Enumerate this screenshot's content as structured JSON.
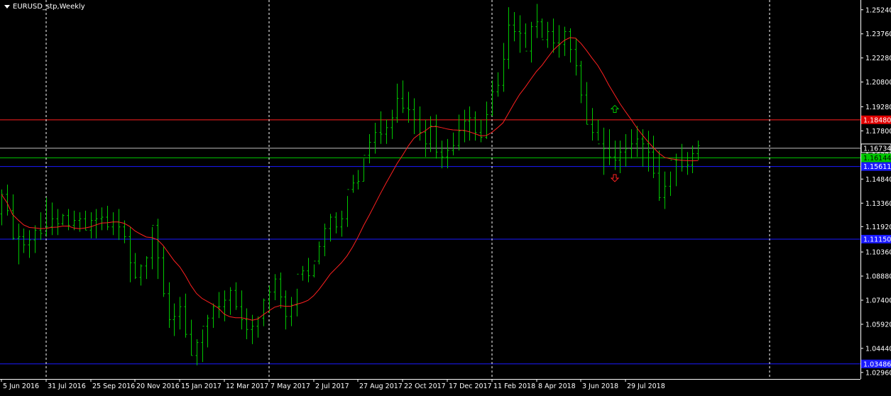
{
  "window": {
    "symbol_title": "EURUSD_stp,Weekly"
  },
  "colors": {
    "background": "#000000",
    "bars": "#00c800",
    "moving_average": "#ff2020",
    "axis_text": "#ffffff",
    "red_level": "#ff2020",
    "blue_level": "#1a1aff",
    "green_level": "#00c800",
    "gray_level": "#c0c0c0",
    "arrow_up": "#00c800",
    "arrow_down": "#ff2020"
  },
  "chart_data": {
    "type": "ohlc",
    "ylim": [
      1.0256,
      1.2584
    ],
    "y_ticks": [
      "1.25240",
      "1.23760",
      "1.22280",
      "1.20800",
      "1.19280",
      "1.17800",
      "1.16320",
      "1.14840",
      "1.13360",
      "1.11920",
      "1.10360",
      "1.08880",
      "1.07400",
      "1.05920",
      "1.04440",
      "1.02960"
    ],
    "x_ticks": [
      "5 Jun 2016",
      "31 Jul 2016",
      "25 Sep 2016",
      "20 Nov 2016",
      "15 Jan 2017",
      "12 Mar 2017",
      "7 May 2017",
      "2 Jul 2017",
      "27 Aug 2017",
      "22 Oct 2017",
      "17 Dec 2017",
      "11 Feb 2018",
      "8 Apr 2018",
      "3 Jun 2018",
      "29 Jul 2018"
    ],
    "levels": [
      {
        "name": "red-resistance",
        "value": 1.1848,
        "label": "1.18480",
        "color": "#ff2020",
        "label_bg": "#e00000"
      },
      {
        "name": "gray-level",
        "value": 1.16734,
        "label": "1.16734",
        "color": "#c0c0c0",
        "label_bg": "#000000"
      },
      {
        "name": "green-current",
        "value": 1.16144,
        "label": "1.16144",
        "color": "#00c800",
        "label_bg": "#00c800"
      },
      {
        "name": "blue-support-1",
        "value": 1.15611,
        "label": "1.15611",
        "color": "#1a1aff",
        "label_bg": "#1a1aff"
      },
      {
        "name": "blue-support-2",
        "value": 1.1115,
        "label": "1.11150",
        "color": "#1a1aff",
        "label_bg": "#1a1aff"
      },
      {
        "name": "blue-support-3",
        "value": 1.03486,
        "label": "1.03486",
        "color": "#1a1aff",
        "label_bg": "#1a1aff"
      }
    ],
    "dashed_separators": [
      1,
      6,
      11
    ],
    "arrows": [
      {
        "name": "buy-arrow",
        "direction": "up",
        "x_index": 14.6,
        "y": 1.1915
      },
      {
        "name": "sell-arrow",
        "direction": "down",
        "x_index": 14.6,
        "y": 1.149
      }
    ],
    "x_start_weeks_before_first_tick": 0,
    "series": [
      {
        "name": "OHLC",
        "open": [
          1.127,
          1.139,
          1.129,
          1.112,
          1.113,
          1.108,
          1.111,
          1.117,
          1.115,
          1.119,
          1.124,
          1.121,
          1.126,
          1.12,
          1.123,
          1.124,
          1.117,
          1.123,
          1.124,
          1.125,
          1.119,
          1.122,
          1.119,
          1.113,
          1.097,
          1.088,
          1.095,
          1.1,
          1.12,
          1.1,
          1.078,
          1.062,
          1.064,
          1.07,
          1.053,
          1.04,
          1.048,
          1.058,
          1.063,
          1.07,
          1.07,
          1.074,
          1.08,
          1.07,
          1.062,
          1.056,
          1.058,
          1.063,
          1.074,
          1.079,
          1.087,
          1.076,
          1.064,
          1.071,
          1.09,
          1.092,
          1.089,
          1.098,
          1.107,
          1.118,
          1.125,
          1.119,
          1.124,
          1.142,
          1.146,
          1.147,
          1.163,
          1.171,
          1.177,
          1.176,
          1.18,
          1.186,
          1.198,
          1.192,
          1.191,
          1.185,
          1.177,
          1.17,
          1.181,
          1.165,
          1.162,
          1.166,
          1.169,
          1.178,
          1.184,
          1.186,
          1.177,
          1.174,
          1.188,
          1.202,
          1.206,
          1.222,
          1.243,
          1.239,
          1.238,
          1.227,
          1.242,
          1.245,
          1.234,
          1.239,
          1.232,
          1.231,
          1.239,
          1.228,
          1.218,
          1.2,
          1.182,
          1.177,
          1.17,
          1.167,
          1.162,
          1.16,
          1.165,
          1.167,
          1.17,
          1.173,
          1.17,
          1.165,
          1.152,
          1.137,
          1.144,
          1.16,
          1.16,
          1.156,
          1.157,
          1.164
        ],
        "high": [
          1.142,
          1.145,
          1.139,
          1.121,
          1.118,
          1.117,
          1.12,
          1.128,
          1.137,
          1.134,
          1.13,
          1.127,
          1.13,
          1.129,
          1.128,
          1.129,
          1.128,
          1.13,
          1.131,
          1.132,
          1.128,
          1.13,
          1.123,
          1.119,
          1.103,
          1.096,
          1.101,
          1.119,
          1.124,
          1.107,
          1.085,
          1.072,
          1.076,
          1.078,
          1.062,
          1.05,
          1.056,
          1.065,
          1.072,
          1.079,
          1.08,
          1.082,
          1.085,
          1.08,
          1.069,
          1.065,
          1.064,
          1.075,
          1.083,
          1.09,
          1.091,
          1.08,
          1.076,
          1.081,
          1.095,
          1.1,
          1.096,
          1.11,
          1.121,
          1.127,
          1.128,
          1.129,
          1.138,
          1.151,
          1.154,
          1.161,
          1.176,
          1.183,
          1.19,
          1.185,
          1.191,
          1.207,
          1.209,
          1.202,
          1.198,
          1.193,
          1.185,
          1.187,
          1.188,
          1.172,
          1.173,
          1.177,
          1.188,
          1.191,
          1.193,
          1.19,
          1.185,
          1.196,
          1.209,
          1.214,
          1.232,
          1.254,
          1.251,
          1.249,
          1.244,
          1.245,
          1.256,
          1.247,
          1.245,
          1.247,
          1.243,
          1.242,
          1.241,
          1.235,
          1.221,
          1.208,
          1.192,
          1.185,
          1.18,
          1.179,
          1.172,
          1.172,
          1.176,
          1.179,
          1.181,
          1.179,
          1.178,
          1.175,
          1.166,
          1.153,
          1.153,
          1.164,
          1.17,
          1.165,
          1.169,
          1.172
        ],
        "low": [
          1.12,
          1.126,
          1.111,
          1.096,
          1.103,
          1.1,
          1.103,
          1.111,
          1.113,
          1.114,
          1.114,
          1.12,
          1.117,
          1.117,
          1.116,
          1.117,
          1.112,
          1.112,
          1.117,
          1.117,
          1.114,
          1.111,
          1.109,
          1.085,
          1.087,
          1.083,
          1.087,
          1.093,
          1.087,
          1.076,
          1.057,
          1.052,
          1.056,
          1.051,
          1.04,
          1.034,
          1.036,
          1.045,
          1.057,
          1.063,
          1.061,
          1.065,
          1.068,
          1.056,
          1.05,
          1.047,
          1.051,
          1.058,
          1.066,
          1.074,
          1.069,
          1.056,
          1.058,
          1.064,
          1.086,
          1.085,
          1.088,
          1.096,
          1.101,
          1.11,
          1.115,
          1.113,
          1.119,
          1.14,
          1.142,
          1.147,
          1.158,
          1.164,
          1.17,
          1.17,
          1.173,
          1.183,
          1.189,
          1.183,
          1.176,
          1.172,
          1.162,
          1.165,
          1.161,
          1.155,
          1.155,
          1.163,
          1.166,
          1.171,
          1.172,
          1.172,
          1.171,
          1.173,
          1.187,
          1.199,
          1.202,
          1.216,
          1.233,
          1.226,
          1.229,
          1.22,
          1.235,
          1.235,
          1.229,
          1.226,
          1.223,
          1.224,
          1.22,
          1.212,
          1.195,
          1.182,
          1.172,
          1.172,
          1.151,
          1.157,
          1.154,
          1.152,
          1.156,
          1.161,
          1.162,
          1.156,
          1.153,
          1.149,
          1.135,
          1.13,
          1.138,
          1.144,
          1.153,
          1.151,
          1.152,
          1.16
        ],
        "close": [
          1.139,
          1.129,
          1.112,
          1.113,
          1.108,
          1.111,
          1.117,
          1.115,
          1.119,
          1.124,
          1.121,
          1.126,
          1.12,
          1.123,
          1.124,
          1.117,
          1.123,
          1.124,
          1.125,
          1.119,
          1.122,
          1.119,
          1.113,
          1.097,
          1.088,
          1.095,
          1.1,
          1.12,
          1.1,
          1.078,
          1.062,
          1.064,
          1.07,
          1.053,
          1.04,
          1.048,
          1.058,
          1.063,
          1.07,
          1.07,
          1.074,
          1.08,
          1.07,
          1.062,
          1.056,
          1.058,
          1.063,
          1.074,
          1.079,
          1.087,
          1.076,
          1.064,
          1.071,
          1.09,
          1.092,
          1.089,
          1.098,
          1.107,
          1.118,
          1.125,
          1.119,
          1.124,
          1.142,
          1.146,
          1.147,
          1.163,
          1.171,
          1.177,
          1.176,
          1.18,
          1.186,
          1.198,
          1.192,
          1.191,
          1.185,
          1.177,
          1.17,
          1.181,
          1.165,
          1.162,
          1.166,
          1.169,
          1.178,
          1.184,
          1.186,
          1.177,
          1.174,
          1.188,
          1.202,
          1.206,
          1.222,
          1.243,
          1.239,
          1.238,
          1.227,
          1.242,
          1.245,
          1.234,
          1.239,
          1.232,
          1.231,
          1.239,
          1.228,
          1.218,
          1.2,
          1.182,
          1.177,
          1.17,
          1.167,
          1.162,
          1.16,
          1.165,
          1.167,
          1.17,
          1.173,
          1.17,
          1.165,
          1.152,
          1.137,
          1.144,
          1.16,
          1.16,
          1.156,
          1.157,
          1.164,
          1.169
        ]
      }
    ],
    "moving_average_period": 13
  }
}
